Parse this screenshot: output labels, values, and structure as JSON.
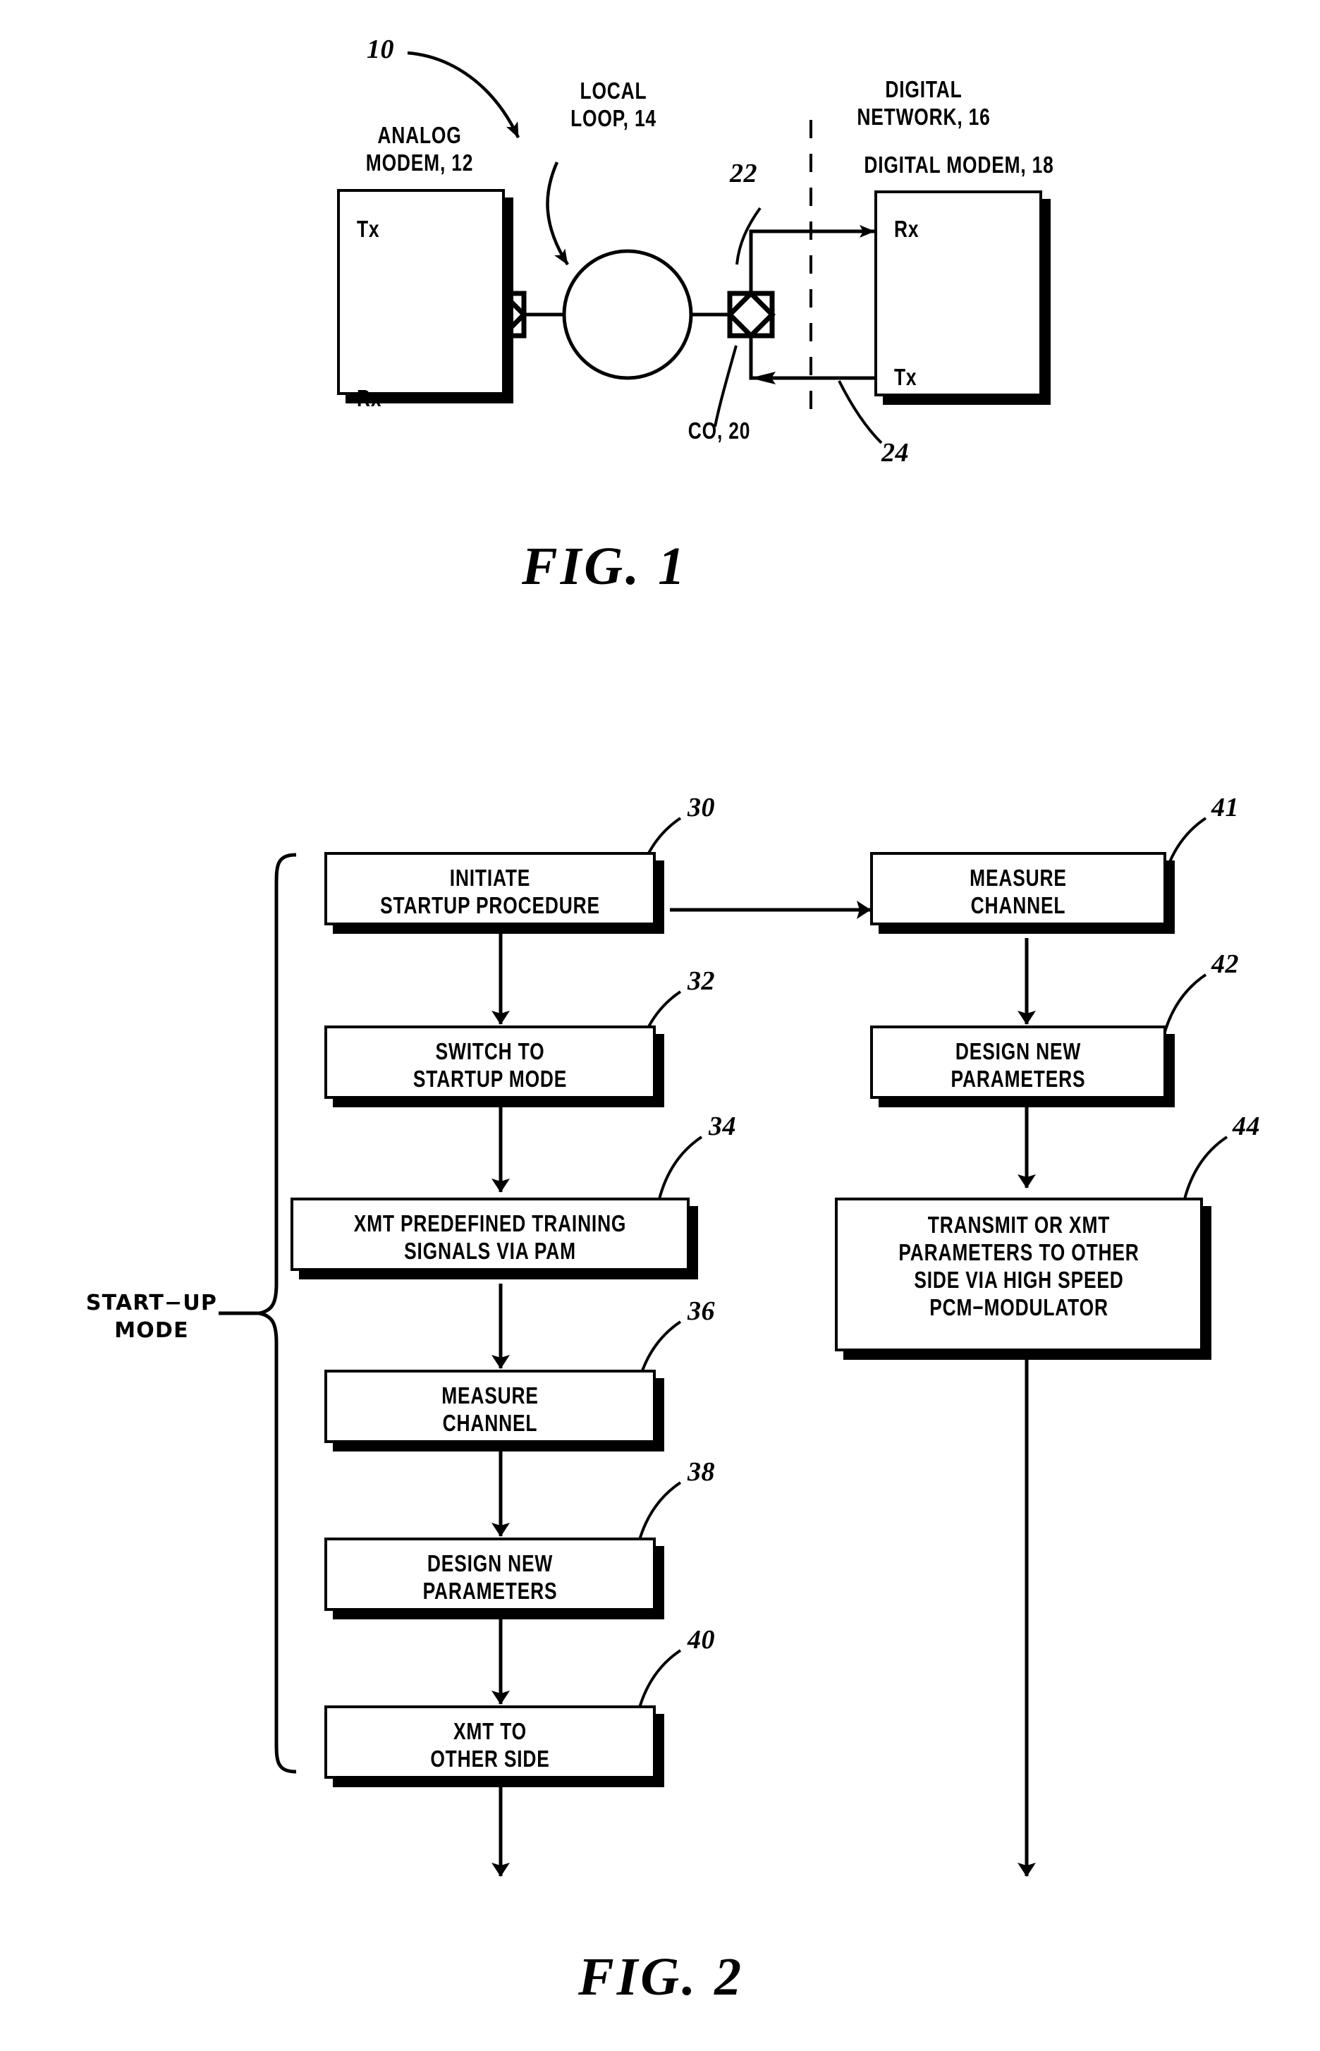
{
  "figure1": {
    "caption": "FIG. 1",
    "ref_10": "10",
    "analog_modem_label": "ANALOG\nMODEM, 12",
    "local_loop_label": "LOCAL\nLOOP, 14",
    "digital_network_label": "DIGITAL\nNETWORK, 16",
    "digital_modem_label": "DIGITAL MODEM, 18",
    "co_label": "CO, 20",
    "ref_22": "22",
    "ref_24": "24",
    "analog_tx": "Tx",
    "analog_rx": "Rx",
    "digital_rx": "Rx",
    "digital_tx": "Tx"
  },
  "figure2": {
    "caption": "FIG. 2",
    "bracket_label": "START−UP\nMODE",
    "left_column": [
      {
        "ref": "30",
        "text": "INITIATE\nSTARTUP PROCEDURE"
      },
      {
        "ref": "32",
        "text": "SWITCH TO\nSTARTUP MODE"
      },
      {
        "ref": "34",
        "text": "XMT PREDEFINED TRAINING\nSIGNALS VIA PAM"
      },
      {
        "ref": "36",
        "text": "MEASURE\nCHANNEL"
      },
      {
        "ref": "38",
        "text": "DESIGN NEW\nPARAMETERS"
      },
      {
        "ref": "40",
        "text": "XMT TO\nOTHER SIDE"
      }
    ],
    "right_column": [
      {
        "ref": "41",
        "text": "MEASURE\nCHANNEL"
      },
      {
        "ref": "42",
        "text": "DESIGN NEW\nPARAMETERS"
      },
      {
        "ref": "44",
        "text": "TRANSMIT OR XMT\nPARAMETERS TO OTHER\nSIDE VIA HIGH SPEED\nPCM−MODULATOR"
      }
    ]
  },
  "colors": {
    "ink": "#000000",
    "paper": "#ffffff"
  }
}
